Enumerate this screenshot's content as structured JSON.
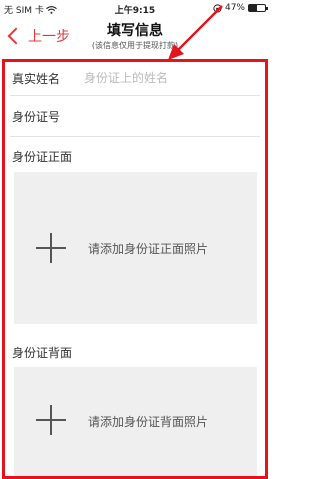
{
  "status_bar": {
    "carrier": "无 SIM 卡",
    "wifi_icon": "wifi-icon",
    "time": "上午9:15",
    "rotation_lock_icon": "rotation-lock-icon",
    "battery_percent": "47%",
    "battery_level": 0.47
  },
  "nav": {
    "back_label": "上一步",
    "title": "填写信息",
    "subtitle": "(该信息仅用于提现打款)"
  },
  "form": {
    "name_label": "真实姓名",
    "name_placeholder": "身份证上的姓名",
    "id_label": "身份证号",
    "front_label": "身份证正面",
    "front_upload_text": "请添加身份证正面照片",
    "back_label": "身份证背面",
    "back_upload_text": "请添加身份证背面照片"
  },
  "annotation": {
    "color": "#e5141c"
  }
}
